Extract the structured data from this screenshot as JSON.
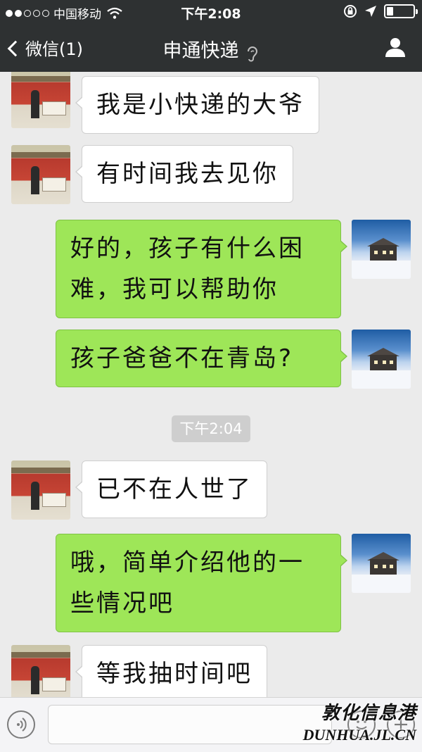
{
  "status_bar": {
    "carrier": "中国移动",
    "time": "下午2:08",
    "signal_bars_filled": 2,
    "signal_bars_total": 5,
    "battery_level": 0.25
  },
  "nav": {
    "back_label": "微信(1)",
    "title": "申通快递",
    "icons": [
      "chevron-left-icon",
      "ear-icon",
      "profile-icon"
    ]
  },
  "messages": [
    {
      "side": "left",
      "text": "我是小快递的大爷"
    },
    {
      "side": "left",
      "text": "有时间我去见你"
    },
    {
      "side": "right",
      "lines": [
        "好的，孩子有什么困",
        "难，我可以帮助你"
      ]
    },
    {
      "side": "right",
      "text": "孩子爸爸不在青岛?"
    },
    {
      "side": "left",
      "text": "已不在人世了"
    },
    {
      "side": "right",
      "lines": [
        "哦，简单介绍他的一",
        "些情况吧"
      ]
    },
    {
      "side": "left",
      "text": "等我抽时间吧"
    }
  ],
  "timestamp": "下午2:04",
  "input": {
    "value": "",
    "icons": [
      "voice-icon",
      "emoji-icon",
      "plus-icon"
    ]
  },
  "watermark": {
    "chinese": "敦化信息港",
    "url": "DUNHUA.JL.CN"
  },
  "colors": {
    "bar_bg": "#2e3132",
    "chat_bg": "#ebebeb",
    "bubble_right": "#9ee658",
    "bubble_left": "#ffffff"
  }
}
